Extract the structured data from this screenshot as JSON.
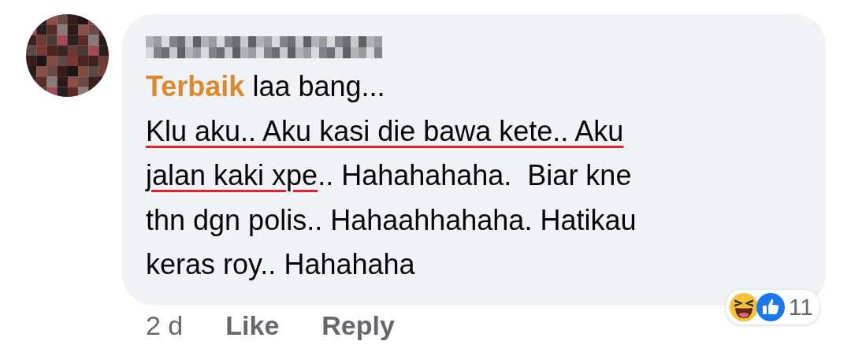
{
  "comment": {
    "avatar": {
      "kind": "picture"
    },
    "lines": [
      [
        {
          "text": "Terbaik",
          "kind": "tag"
        },
        {
          "text": " laa bang...",
          "kind": "plain"
        }
      ],
      [
        {
          "text": "Klu aku.. Aku kasi die bawa kete.. Aku",
          "kind": "underlined"
        }
      ],
      [
        {
          "text": "jalan kaki xpe",
          "kind": "underlined"
        },
        {
          "text": ".. Hahahahaha.  Biar kne",
          "kind": "plain"
        }
      ],
      [
        {
          "text": "thn dgn polis.. Hahaahhahaha. Hatikau",
          "kind": "plain"
        }
      ],
      [
        {
          "text": "keras roy.. Hahahaha",
          "kind": "plain"
        }
      ]
    ],
    "reactions": {
      "count": "11"
    },
    "footer": {
      "time": "2 d",
      "actions": [
        "Like",
        "Reply"
      ]
    }
  }
}
